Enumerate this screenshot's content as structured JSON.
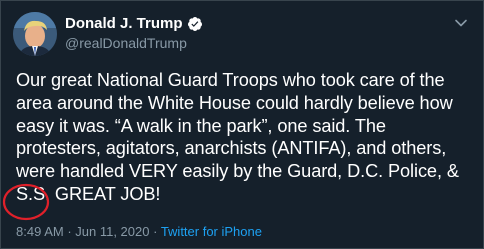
{
  "user": {
    "display_name": "Donald J. Trump",
    "handle": "@realDonaldTrump",
    "verified": true
  },
  "tweet": {
    "text": "Our great National Guard Troops who took care of the\narea around the White House could hardly believe how\neasy it was. “A walk in the park”, one said. The\nprotesters, agitators, anarchists (ANTIFA), and others,\nwere handled VERY easily by the Guard, D.C. Police, &\nS.S. GREAT JOB!"
  },
  "meta": {
    "time": "8:49 AM",
    "date": "Jun 11, 2020",
    "separator": " · ",
    "source": "Twitter for iPhone"
  },
  "annotation": {
    "color": "#e0202a"
  },
  "colors": {
    "background": "#15202b",
    "secondary_text": "#8899a6",
    "link": "#1da1f2"
  },
  "icons": {
    "verified": "verified-badge-icon",
    "caret": "chevron-down-icon"
  }
}
